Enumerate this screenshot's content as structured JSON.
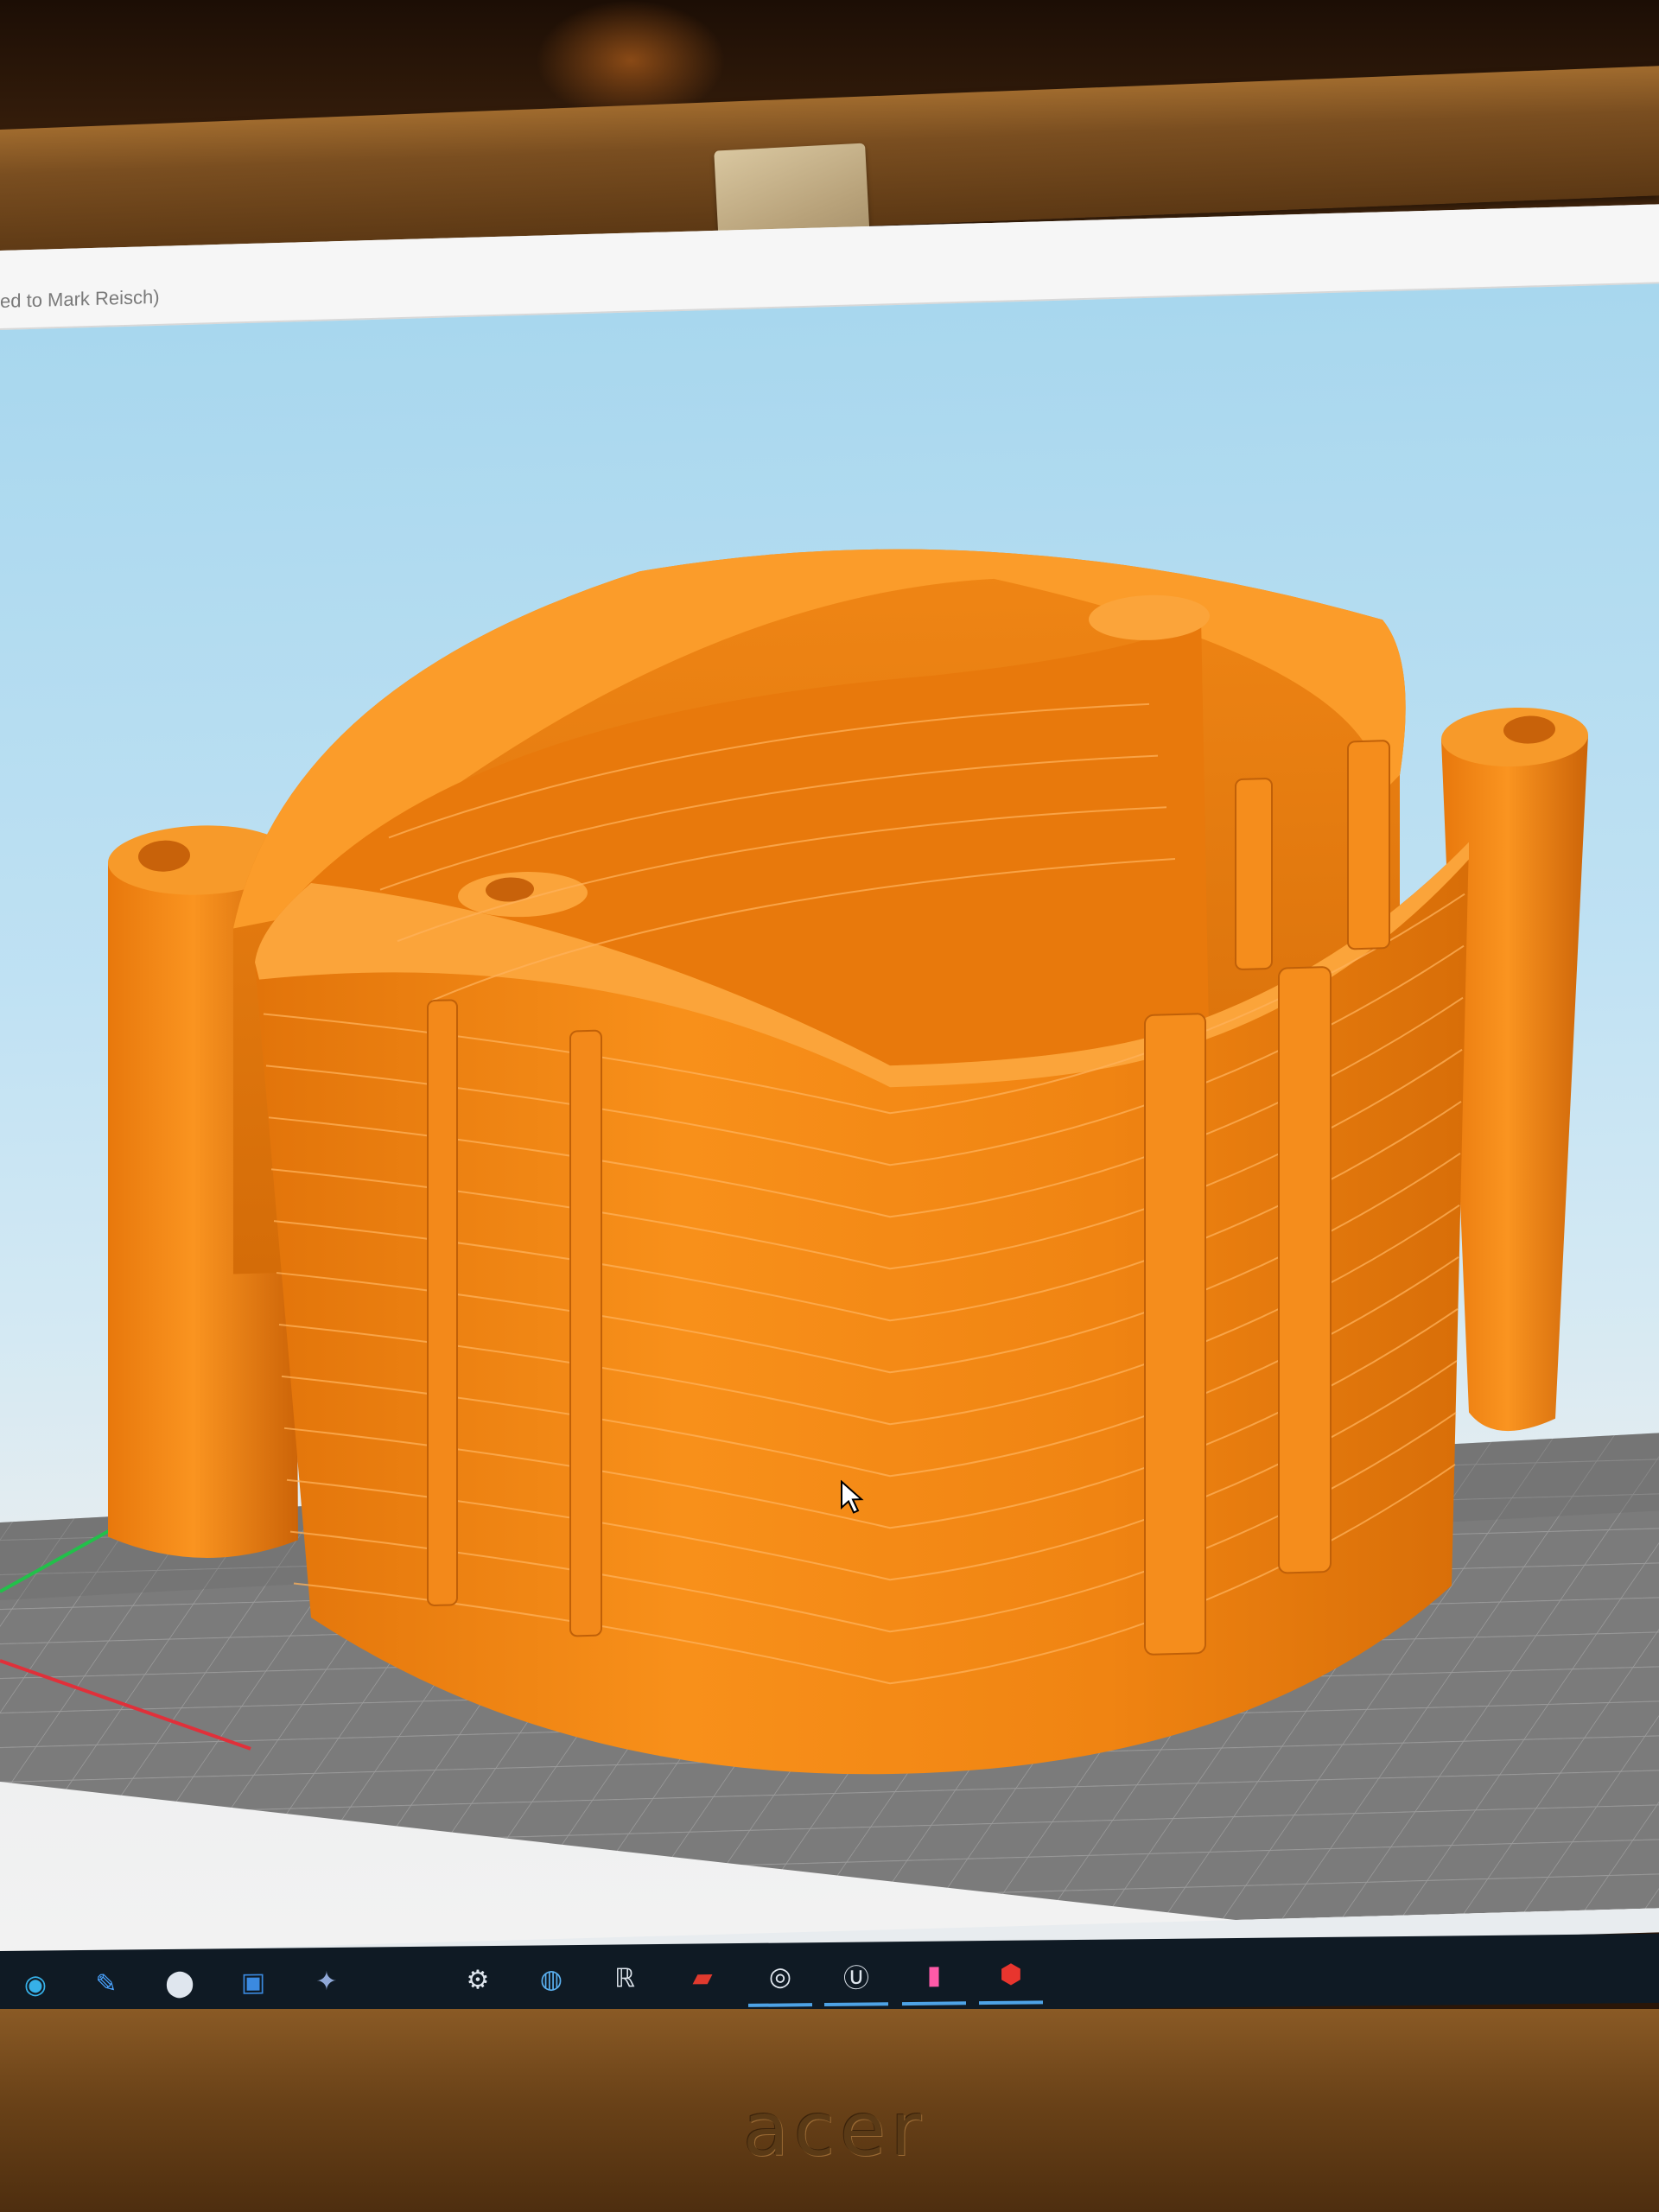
{
  "window": {
    "title_fragment": "ed to Mark Reisch)"
  },
  "viewport": {
    "sky_color": "#a8d7ee",
    "bed_color": "#7d7d7d",
    "model_color": "#f58a0f",
    "model_shadow_color": "#c8620a",
    "axis_x_color": "#e0303a",
    "axis_y_color": "#22c04a",
    "cursor_icon": "mouse-pointer-icon"
  },
  "taskbar": {
    "background": "#0f1a24",
    "icons": [
      {
        "name": "edge-browser-icon",
        "glyph": "◉",
        "color": "#36b0e8",
        "active": false
      },
      {
        "name": "drawing-app-icon",
        "glyph": "✎",
        "color": "#4aa3ff",
        "active": false
      },
      {
        "name": "maps-icon",
        "glyph": "⬤",
        "color": "#dfe6ee",
        "active": false
      },
      {
        "name": "window-app-icon",
        "glyph": "▣",
        "color": "#3b8ae0",
        "active": false
      },
      {
        "name": "photos-app-icon",
        "glyph": "✦",
        "color": "#8fa8d8",
        "active": false
      },
      {
        "name": "settings-gear-icon",
        "glyph": "⚙",
        "color": "#dfe6ee",
        "active": false
      },
      {
        "name": "globe-icon",
        "glyph": "◍",
        "color": "#5ab0f0",
        "active": false
      },
      {
        "name": "app-r-icon",
        "glyph": "ℝ",
        "color": "#dfe6ee",
        "active": false
      },
      {
        "name": "red-app-icon",
        "glyph": "▰",
        "color": "#e03a2e",
        "active": false
      },
      {
        "name": "round-app-icon",
        "glyph": "◎",
        "color": "#dfe6ee",
        "active": true
      },
      {
        "name": "unreal-engine-icon",
        "glyph": "Ⓤ",
        "color": "#dfe6ee",
        "active": true
      },
      {
        "name": "slicer-app-icon",
        "glyph": "▮",
        "color": "#ff5aa8",
        "active": true
      },
      {
        "name": "red-hex-app-icon",
        "glyph": "⬢",
        "color": "#e8352e",
        "active": true
      }
    ]
  },
  "monitor": {
    "brand": "acer",
    "bezel_color": "#6a4218"
  }
}
